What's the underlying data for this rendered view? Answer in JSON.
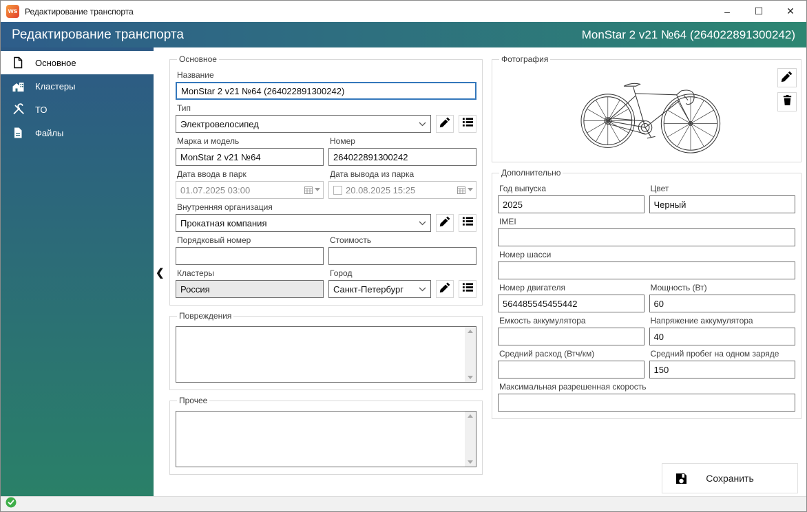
{
  "window": {
    "title": "Редактирование транспорта",
    "app_icon_text": "ws",
    "controls": {
      "minimize": "–",
      "maximize": "☐",
      "close": "✕"
    }
  },
  "header": {
    "title": "Редактирование транспорта",
    "vehicle_id": "MonStar 2 v21 №64 (264022891300242)"
  },
  "sidebar": {
    "collapse_glyph": "❮",
    "items": [
      {
        "label": "Основное",
        "selected": true
      },
      {
        "label": "Кластеры",
        "selected": false
      },
      {
        "label": "ТО",
        "selected": false
      },
      {
        "label": "Файлы",
        "selected": false
      }
    ]
  },
  "main": {
    "group_main": {
      "legend": "Основное",
      "name": {
        "label": "Название",
        "value": "MonStar 2 v21 №64 (264022891300242)"
      },
      "type": {
        "label": "Тип",
        "value": "Электровелосипед"
      },
      "brand": {
        "label": "Марка и модель",
        "value": "MonStar 2 v21 №64"
      },
      "number": {
        "label": "Номер",
        "value": "264022891300242"
      },
      "date_in": {
        "label": "Дата ввода в парк",
        "value": "01.07.2025 03:00"
      },
      "date_out": {
        "label": "Дата вывода из парка",
        "value": "20.08.2025 15:25",
        "checked": false
      },
      "org": {
        "label": "Внутренняя организация",
        "value": "Прокатная компания"
      },
      "serial": {
        "label": "Порядковый номер",
        "value": ""
      },
      "cost": {
        "label": "Стоимость",
        "value": ""
      },
      "clusters": {
        "label": "Кластеры",
        "value": "Россия"
      },
      "city": {
        "label": "Город",
        "value": "Санкт-Петербург"
      }
    },
    "group_damage": {
      "legend": "Повреждения",
      "value": ""
    },
    "group_other": {
      "legend": "Прочее",
      "value": ""
    },
    "group_photo": {
      "legend": "Фотография"
    },
    "group_additional": {
      "legend": "Дополнительно",
      "year": {
        "label": "Год выпуска",
        "value": "2025"
      },
      "color": {
        "label": "Цвет",
        "value": "Черный"
      },
      "imei": {
        "label": "IMEI",
        "value": ""
      },
      "chassis": {
        "label": "Номер шасси",
        "value": ""
      },
      "engine": {
        "label": "Номер двигателя",
        "value": "564485545455442"
      },
      "power": {
        "label": "Мощность (Вт)",
        "value": "60"
      },
      "battery_capacity": {
        "label": "Емкость аккумулятора",
        "value": ""
      },
      "battery_voltage": {
        "label": "Напряжение аккумулятора",
        "value": "40"
      },
      "avg_consumption": {
        "label": "Средний расход (Втч/км)",
        "value": ""
      },
      "avg_range": {
        "label": "Средний пробег на одном заряде",
        "value": "150"
      },
      "max_speed": {
        "label": "Максимальная разрешенная скорость",
        "value": ""
      }
    },
    "save_button": {
      "label": "Сохранить"
    }
  },
  "statusbar": {
    "status_icon": "success-check"
  },
  "colors": {
    "header_gradient_left": "#2e5d8a",
    "header_gradient_right": "#2d8672",
    "sidebar_gradient_top": "#2d5a85",
    "sidebar_gradient_bottom": "#2a8068",
    "focus_border": "#3377bb",
    "status_success": "#3fae49",
    "app_icon_gradient": [
      "#f59b3d",
      "#e23e2e"
    ]
  }
}
